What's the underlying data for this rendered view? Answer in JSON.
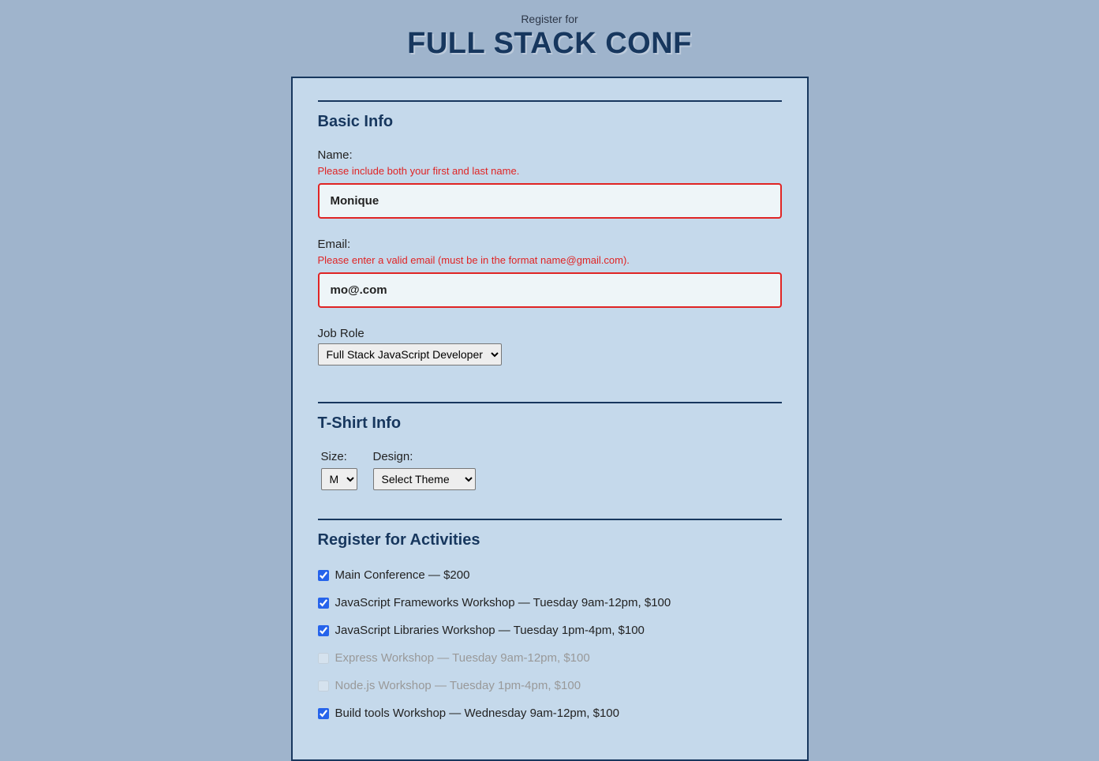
{
  "header": {
    "pretitle": "Register for",
    "title": "FULL STACK CONF"
  },
  "basic_info": {
    "section_title": "Basic Info",
    "name_label": "Name:",
    "name_error": "Please include both your first and last name.",
    "name_value": "Monique",
    "email_label": "Email:",
    "email_error": "Please enter a valid email (must be in the format name@gmail.com).",
    "email_value": "mo@.com",
    "job_label": "Job Role",
    "job_value": "Full Stack JavaScript Developer"
  },
  "tshirt": {
    "section_title": "T-Shirt Info",
    "size_label": "Size:",
    "size_value": "M",
    "design_label": "Design:",
    "design_value": "Select Theme"
  },
  "activities": {
    "section_title": "Register for Activities",
    "items": [
      {
        "label": "Main Conference — $200",
        "checked": true,
        "disabled": false
      },
      {
        "label": "JavaScript Frameworks Workshop — Tuesday 9am-12pm, $100",
        "checked": true,
        "disabled": false
      },
      {
        "label": "JavaScript Libraries Workshop — Tuesday 1pm-4pm, $100",
        "checked": true,
        "disabled": false
      },
      {
        "label": "Express Workshop — Tuesday 9am-12pm, $100",
        "checked": false,
        "disabled": true
      },
      {
        "label": "Node.js Workshop — Tuesday 1pm-4pm, $100",
        "checked": false,
        "disabled": true
      },
      {
        "label": "Build tools Workshop — Wednesday 9am-12pm, $100",
        "checked": true,
        "disabled": false
      }
    ]
  }
}
